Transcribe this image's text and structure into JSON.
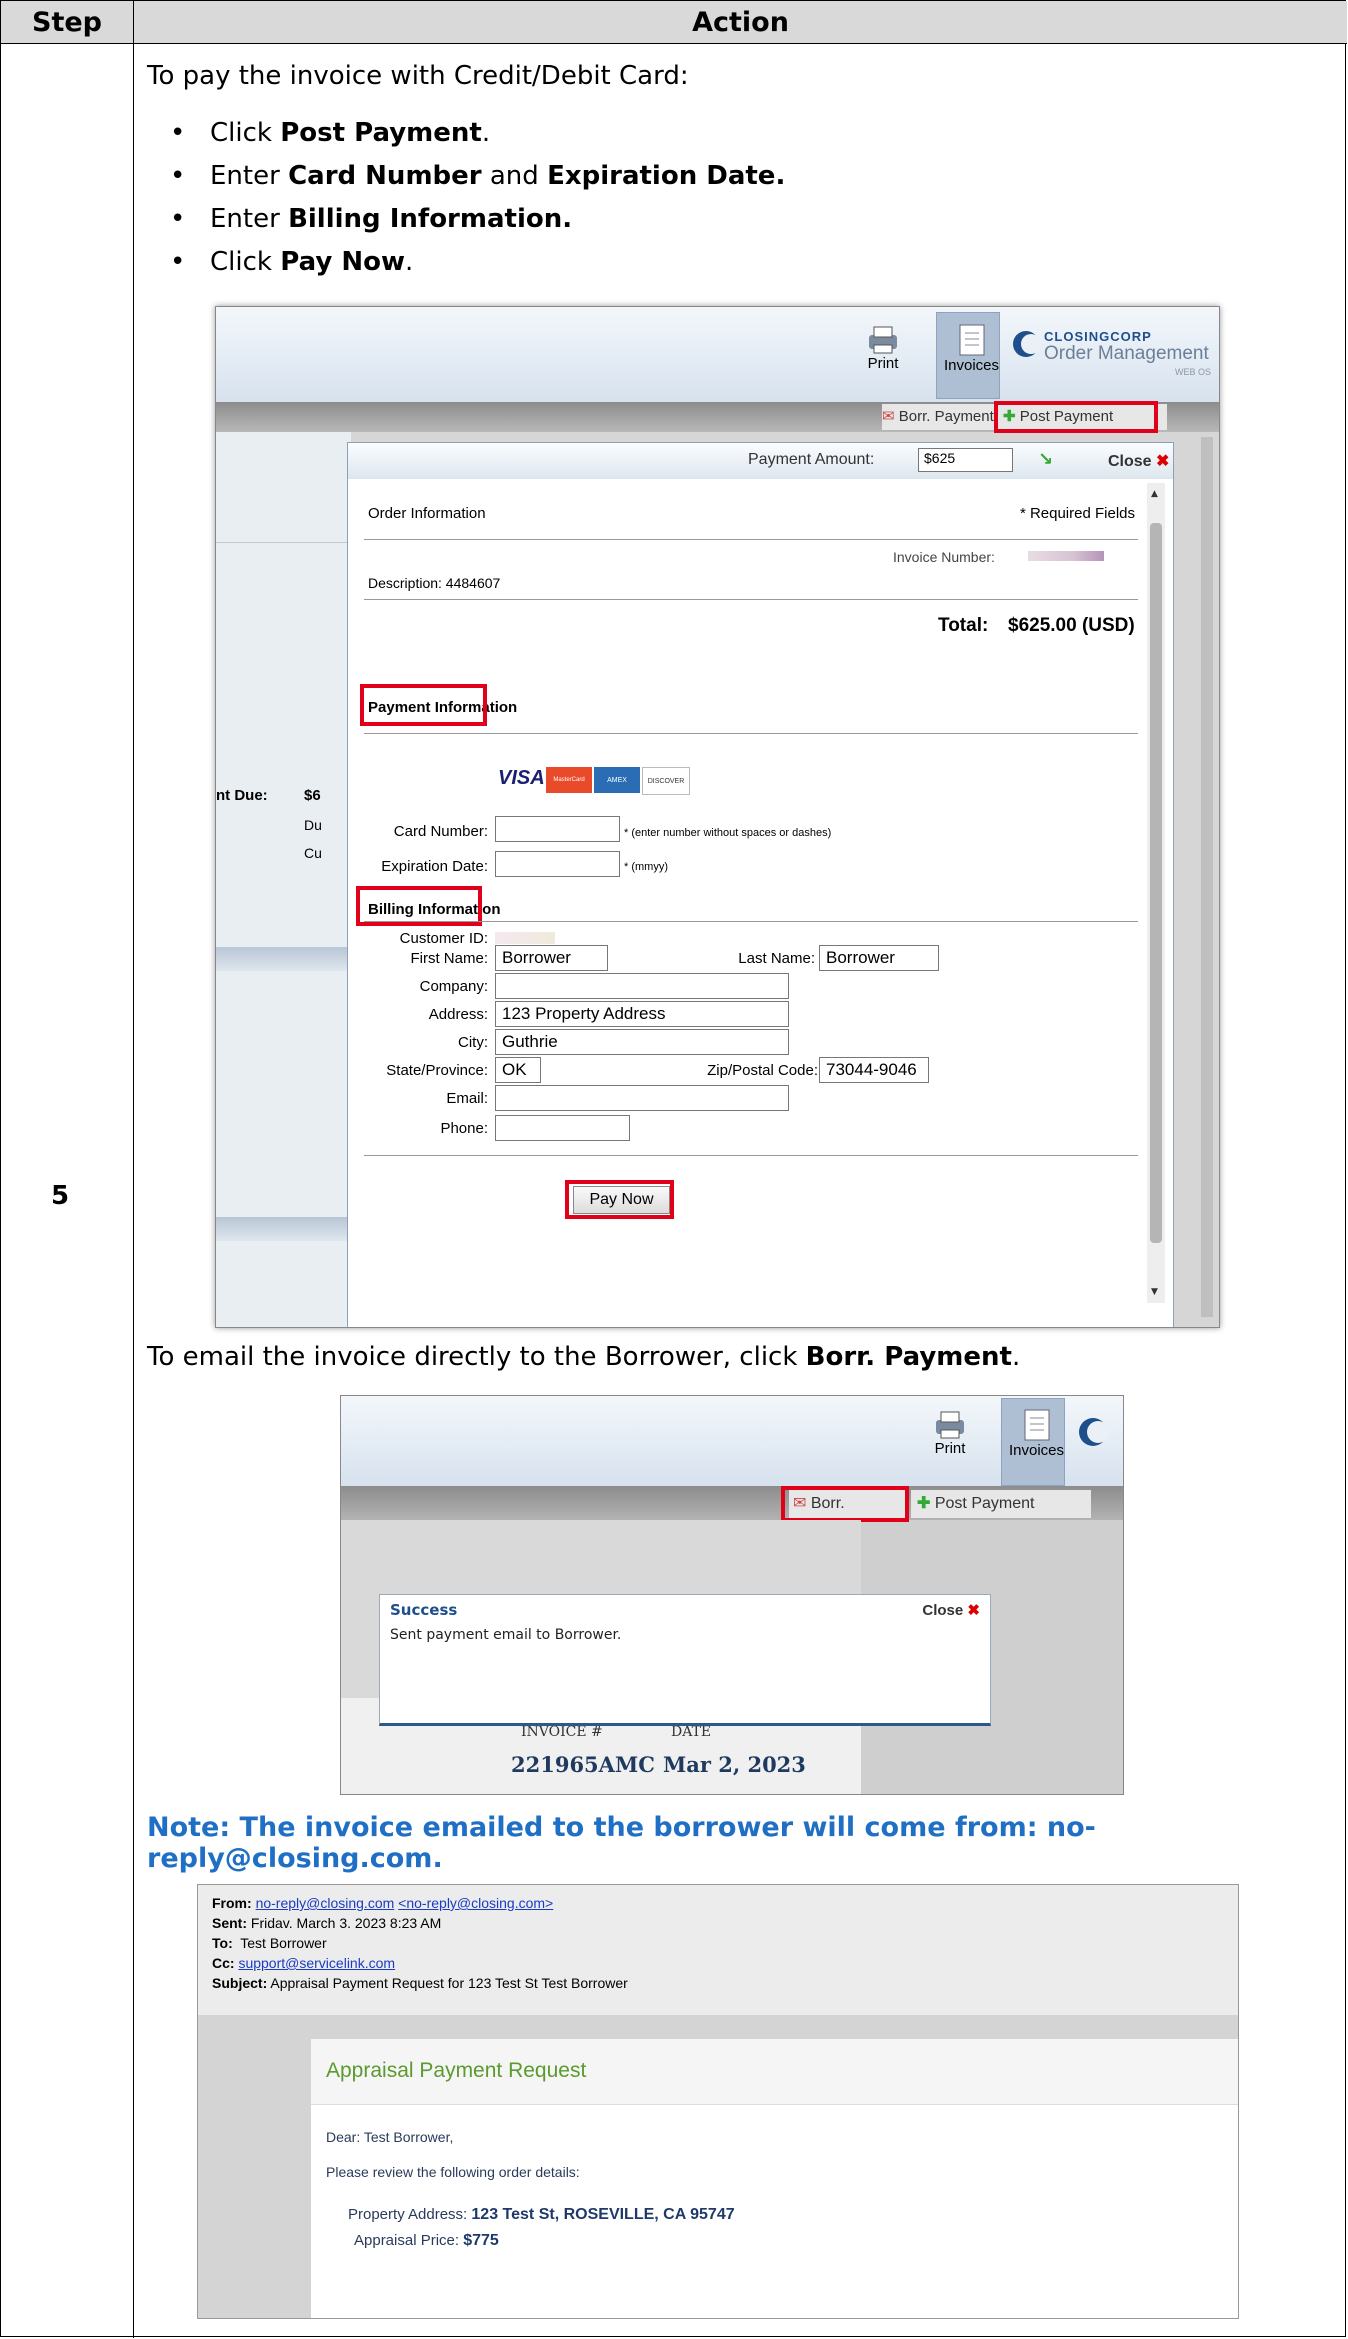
{
  "table": {
    "col_step": "Step",
    "col_action": "Action",
    "step_number": "5"
  },
  "intro": "To pay the invoice with Credit/Debit Card:",
  "bullets": [
    {
      "pre": "Click ",
      "bold": "Post Payment",
      "post": "."
    },
    {
      "pre": "Enter ",
      "bold": "Card Number",
      "mid": " and ",
      "bold2": "Expiration Date.",
      "post": ""
    },
    {
      "pre": "Enter ",
      "bold": "Billing Information.",
      "post": ""
    },
    {
      "pre": "Click ",
      "bold": "Pay Now",
      "post": "."
    }
  ],
  "ss1": {
    "print": "Print",
    "invoices": "Invoices",
    "brand_top": "CLOSINGCORP",
    "brand_sub": "Order Management",
    "brand_ver": "WEB OS",
    "tab_borr": "Borr. Payment",
    "tab_post": "Post Payment",
    "payment_amount_label": "Payment Amount:",
    "payment_amount_value": "$625",
    "close": "Close",
    "order_info": "Order Information",
    "required": "* Required Fields",
    "invoice_number_label": "Invoice Number:",
    "description": "Description: 4484607",
    "total_label": "Total:",
    "total_value": "$625.00 (USD)",
    "payment_info": "Payment Information",
    "card_logos": [
      "VISA",
      "MasterCard",
      "AMEX",
      "DISCOVER"
    ],
    "card_number_label": "Card Number:",
    "card_number_hint": "* (enter number without spaces or dashes)",
    "exp_label": "Expiration Date:",
    "exp_hint": "* (mmyy)",
    "billing_info": "Billing Information",
    "customer_id_label": "Customer ID:",
    "first_name_label": "First Name:",
    "first_name": "Borrower",
    "last_name_label": "Last Name:",
    "last_name": "Borrower",
    "company_label": "Company:",
    "address_label": "Address:",
    "address": "123 Property Address",
    "city_label": "City:",
    "city": "Guthrie",
    "state_label": "State/Province:",
    "state": "OK",
    "zip_label": "Zip/Postal Code:",
    "zip": "73044-9046",
    "email_label": "Email:",
    "phone_label": "Phone:",
    "pay_now": "Pay Now",
    "bg_amount_label": "nt Due:",
    "bg_amount": "$6",
    "bg_du": "Du",
    "bg_cu": "Cu"
  },
  "email_line": {
    "pre": "To email the invoice directly to the Borrower, click ",
    "bold": "Borr. Payment",
    "post": "."
  },
  "ss2": {
    "print": "Print",
    "invoices": "Invoices",
    "tab_borr": "Borr. Payment",
    "tab_post": "Post Payment",
    "success_title": "Success",
    "close": "Close",
    "success_msg": "Sent payment email to Borrower.",
    "col_invoice": "INVOICE #",
    "col_date": "DATE",
    "invoice_no": "221965AMC",
    "invoice_date": "Mar 2, 2023"
  },
  "note": "Note:  The invoice emailed to the borrower will come from: no-reply@closing.com.",
  "ss3": {
    "from_label": "From:",
    "from_addr": "no-reply@closing.com",
    "from_addr2": "<no-reply@closing.com>",
    "sent_label": "Sent:",
    "sent": "Fridav. March 3. 2023 8:23 AM",
    "to_label": "To:",
    "to": "Test Borrower",
    "cc_label": "Cc:",
    "cc": "support@servicelink.com",
    "subject_label": "Subject:",
    "subject": "Appraisal Payment Request for 123 Test St Test Borrower",
    "heading": "Appraisal Payment Request",
    "dear": "Dear: Test Borrower,",
    "review": "Please review the following order details:",
    "prop_label": "Property Address:",
    "prop": "123 Test St, ROSEVILLE, CA 95747",
    "price_label": "Appraisal Price:",
    "price": "$775"
  },
  "colors": {
    "header_bg": "#d9d9d9",
    "note": "#1f6fc5",
    "highlight": "#e1001a",
    "link": "#1a3cc4",
    "green_heading": "#5a9a2e"
  }
}
